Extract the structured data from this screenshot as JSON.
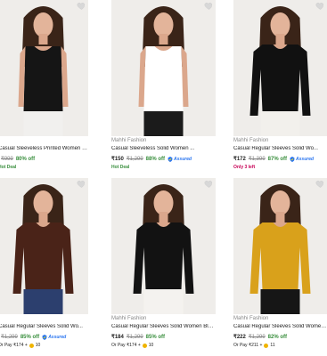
{
  "products": [
    {
      "brand": "",
      "title": "Casual Sleeveless Printed Women Black Top",
      "price": "",
      "mrp": "₹999",
      "discount": "80% off",
      "tag": "Hot Deal",
      "tag_color": "green",
      "assured": false,
      "pay_text": "",
      "pay_coins": "",
      "top_color": "#151515",
      "bottom_color": "#f1f0ee",
      "style": "sleeveless"
    },
    {
      "brand": "Mahhi Fashion",
      "title": "Casual Sleeveless Solid Women ...",
      "price": "₹150",
      "mrp": "₹1,299",
      "discount": "88% off",
      "tag": "Hot Deal",
      "tag_color": "green",
      "assured": true,
      "assured_label": "Assured",
      "pay_text": "",
      "pay_coins": "",
      "top_color": "#ffffff",
      "bottom_color": "#1b1b1b",
      "style": "sleeveless"
    },
    {
      "brand": "Mahhi Fashion",
      "title": "Casual Regular Sleeves Solid Wo...",
      "price": "₹172",
      "mrp": "₹1,399",
      "discount": "87% off",
      "tag": "Only 3 left",
      "tag_color": "red",
      "assured": true,
      "assured_label": "Assured",
      "pay_text": "",
      "pay_coins": "",
      "top_color": "#111111",
      "bottom_color": "#f2f0ec",
      "style": "long"
    },
    {
      "brand": "",
      "title": "Casual Regular Sleeves Solid Wo...",
      "price": "",
      "mrp": "₹1,299",
      "discount": "85% off",
      "tag": "",
      "tag_color": "",
      "assured": true,
      "assured_label": "Assured",
      "pay_text": "Or Pay ₹174 +",
      "pay_coins": "10",
      "top_color": "#4a2318",
      "bottom_color": "#2c3f6e",
      "style": "long"
    },
    {
      "brand": "Mahhi Fashion",
      "title": "Casual Regular Sleeves Solid Women Black T...",
      "price": "₹184",
      "mrp": "₹1,299",
      "discount": "85% off",
      "tag": "",
      "tag_color": "",
      "assured": false,
      "pay_text": "Or Pay ₹174 +",
      "pay_coins": "10",
      "top_color": "#121212",
      "bottom_color": "#f4f2ef",
      "style": "long"
    },
    {
      "brand": "Mahhi Fashion",
      "title": "Casual Regular Sleeves Solid Women Yello...",
      "price": "₹222",
      "mrp": "₹1,299",
      "discount": "82% off",
      "tag": "",
      "tag_color": "",
      "assured": false,
      "pay_text": "Or Pay ₹211 +",
      "pay_coins": "11",
      "top_color": "#d9a11b",
      "bottom_color": "#161616",
      "style": "long"
    }
  ]
}
